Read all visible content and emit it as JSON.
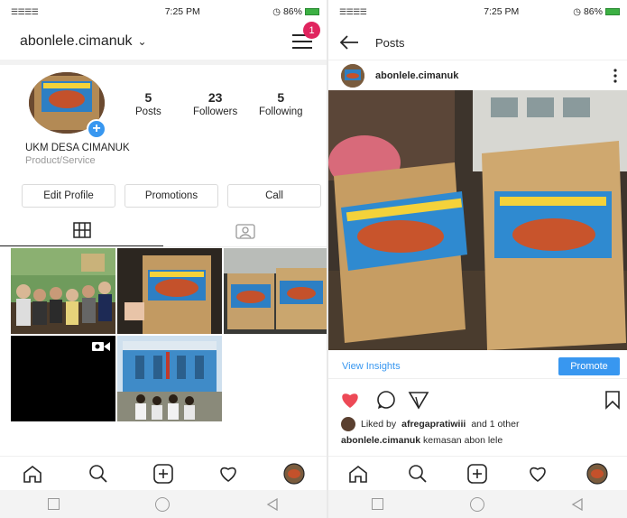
{
  "left": {
    "status": {
      "signal": "☰☰☰☰",
      "time": "7:25 PM",
      "battery": "86%"
    },
    "header": {
      "username": "abonlele.cimanuk",
      "chevron": "⌄",
      "notification_count": "1"
    },
    "stats": [
      {
        "value": "5",
        "label": "Posts"
      },
      {
        "value": "23",
        "label": "Followers"
      },
      {
        "value": "5",
        "label": "Following"
      }
    ],
    "bio": {
      "name": "UKM DESA CIMANUK",
      "category": "Product/Service"
    },
    "buttons": {
      "edit_profile": "Edit Profile",
      "promotions": "Promotions",
      "call": "Call"
    },
    "tabs": {
      "grid": "grid-icon",
      "tagged": "tagged-photos-icon"
    },
    "nav": [
      "home-icon",
      "search-icon",
      "add-icon",
      "heart-icon",
      "profile-avatar"
    ]
  },
  "right": {
    "status": {
      "time": "7:25 PM",
      "battery": "86%"
    },
    "header": {
      "title": "Posts"
    },
    "post": {
      "username": "abonlele.cimanuk",
      "insights": "View Insights",
      "promote": "Promote",
      "liked_prefix": "Liked by",
      "liked_user": "afregapratiwiii",
      "liked_suffix": "and 1 other",
      "caption_user": "abonlele.cimanuk",
      "caption_text": "kemasan abon lele"
    }
  },
  "colors": {
    "accent": "#3897f0",
    "like": "#ed4956",
    "badge": "#e0245e"
  }
}
